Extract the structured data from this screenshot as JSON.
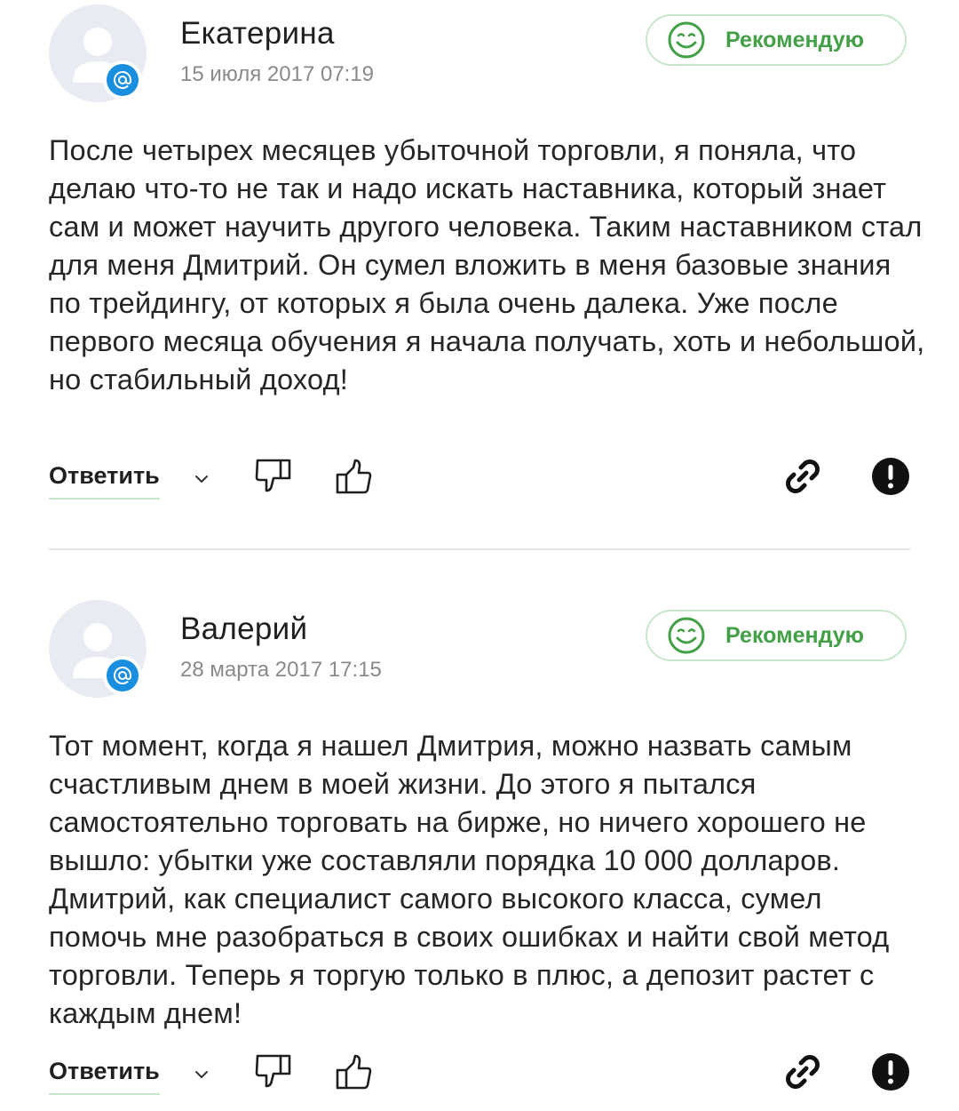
{
  "reviews": [
    {
      "author": "Екатерина",
      "date": "15 июля 2017 07:19",
      "badge": "Рекомендую",
      "text": "После четырех месяцев убыточной торговли, я поняла, что делаю что-то не так и надо искать наставника, который знает сам и может научить другого человека. Таким наставником стал для меня Дмитрий. Он сумел вложить в меня базовые знания по трейдингу, от которых я была очень далека. Уже после первого месяца обучения я начала получать, хоть и небольшой, но стабильный доход!",
      "reply_label": "Ответить"
    },
    {
      "author": "Валерий",
      "date": "28 марта 2017 17:15",
      "badge": "Рекомендую",
      "text": "Тот момент, когда я нашел Дмитрия, можно назвать самым счастливым днем в моей жизни. До этого я пытался самостоятельно торговать на бирже, но ничего хорошего не вышло: убытки уже составляли порядка 10 000 долларов. Дмитрий, как специалист самого высокого класса, сумел помочь мне разобраться в своих ошибках и найти свой метод торговли. Теперь я торгую только в плюс, а депозит растет с каждым днем!",
      "reply_label": "Ответить"
    }
  ],
  "icons": {
    "avatar": "user-avatar-icon",
    "badge": "mail-at-icon",
    "recommend": "smile-icon",
    "expand": "chevron-down-icon",
    "dislike": "thumbs-down-icon",
    "like": "thumbs-up-icon",
    "share": "link-icon",
    "report": "exclamation-icon"
  },
  "colors": {
    "accent_green": "#43a047",
    "recommend_border": "#c8e6c9",
    "mail_blue": "#1a8fe0",
    "avatar_bg": "#e8ebf1",
    "date_gray": "#8a8a8a"
  }
}
